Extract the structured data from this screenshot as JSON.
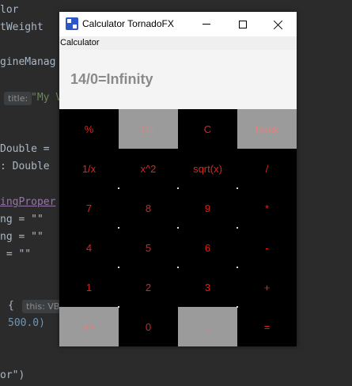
{
  "ide": {
    "lines": [
      "lor",
      "tWeight",
      "gineManag",
      "Double =",
      ": Double",
      "ingProper",
      "ng = \"\"",
      "ng = \"\"",
      " = \"\"",
      "{",
      "500.0)",
      "or\")"
    ],
    "hint_title": "title:",
    "hint_title_value": "\"My V",
    "hint_this": "this: VB"
  },
  "window": {
    "title": "Calculator TornadoFX",
    "icon": "calculator-app-icon",
    "menu": "Calculator",
    "display": "14/0=Infinity"
  },
  "keypad": {
    "rows": [
      [
        "%",
        "CE",
        "C",
        "Back"
      ],
      [
        "1/x",
        "x^2",
        "sqrt(x)",
        "/"
      ],
      [
        "7",
        "8",
        "9",
        "*"
      ],
      [
        "4",
        "5",
        "6",
        "-"
      ],
      [
        "1",
        "2",
        "3",
        "+"
      ],
      [
        "+/-",
        "0",
        ",",
        "="
      ]
    ]
  },
  "colors": {
    "key_text": "#e0201e",
    "key_bg": "#000000",
    "key_gray_bg": "#9b9b9b",
    "display_text": "#8a8a8a"
  }
}
